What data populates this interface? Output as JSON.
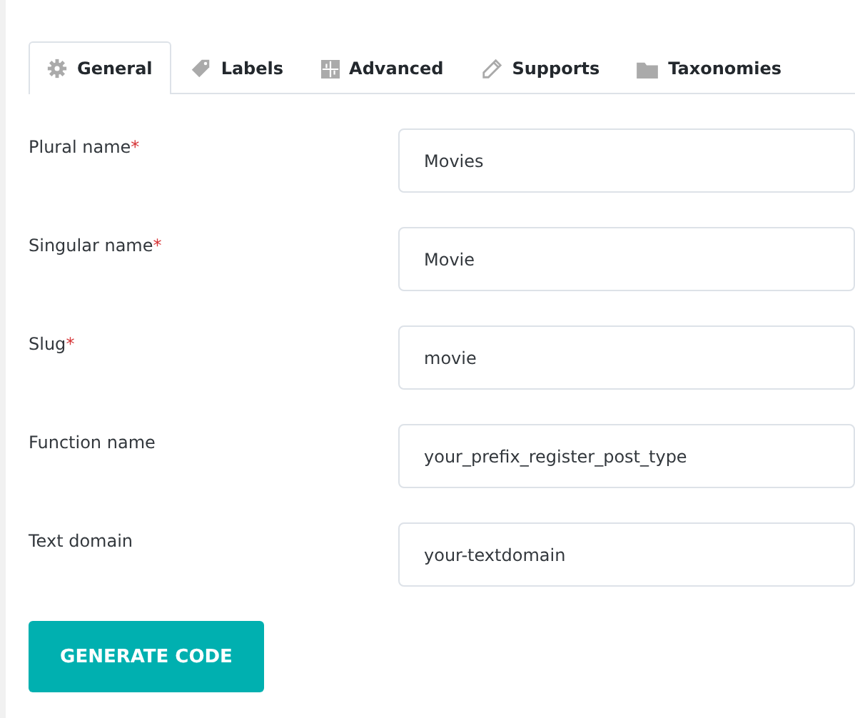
{
  "tabs": [
    {
      "label": "General",
      "kind": "gear",
      "selected": true
    },
    {
      "label": "Labels",
      "kind": "tag",
      "selected": false
    },
    {
      "label": "Advanced",
      "kind": "grid",
      "selected": false
    },
    {
      "label": "Supports",
      "kind": "pencil",
      "selected": false
    },
    {
      "label": "Taxonomies",
      "kind": "folder",
      "selected": false
    }
  ],
  "fields": [
    {
      "label": "Plural name",
      "required_mark": "*",
      "value": "Movies"
    },
    {
      "label": "Singular name",
      "required_mark": "*",
      "value": "Movie"
    },
    {
      "label": "Slug",
      "required_mark": "*",
      "value": "movie"
    },
    {
      "label": "Function name",
      "value": "your_prefix_register_post_type"
    },
    {
      "label": "Text domain",
      "value": "your-textdomain"
    }
  ],
  "button": "GENERATE CODE"
}
